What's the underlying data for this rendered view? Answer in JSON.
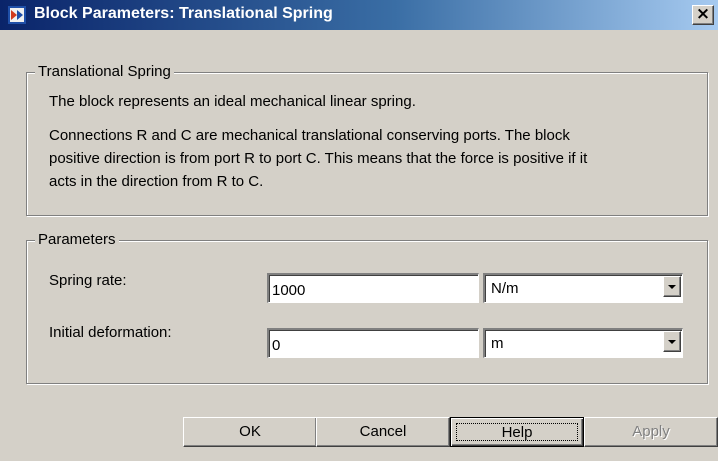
{
  "window": {
    "title": "Block Parameters: Translational Spring",
    "icon": "simulink-block-icon",
    "close_symbol": "×"
  },
  "description_group": {
    "legend": "Translational Spring",
    "paragraph1": "The block represents an ideal mechanical linear spring.",
    "paragraph2_line1": "Connections R and C are mechanical translational conserving ports. The block",
    "paragraph2_line2": "positive direction is from port R to port C. This means that the force is positive if it",
    "paragraph2_line3": "acts in the direction from R to C."
  },
  "parameters_group": {
    "legend": "Parameters",
    "spring_rate": {
      "label": "Spring rate:",
      "value": "1000",
      "unit": "N/m"
    },
    "initial_deformation": {
      "label": "Initial deformation:",
      "value": "0",
      "unit": "m"
    }
  },
  "buttons": {
    "ok": "OK",
    "cancel": "Cancel",
    "help": "Help",
    "apply": "Apply"
  },
  "colors": {
    "dialog_bg": "#d4d0c8",
    "titlebar_start": "#0a246a",
    "titlebar_end": "#a6caf0",
    "disabled_text": "#808080"
  }
}
